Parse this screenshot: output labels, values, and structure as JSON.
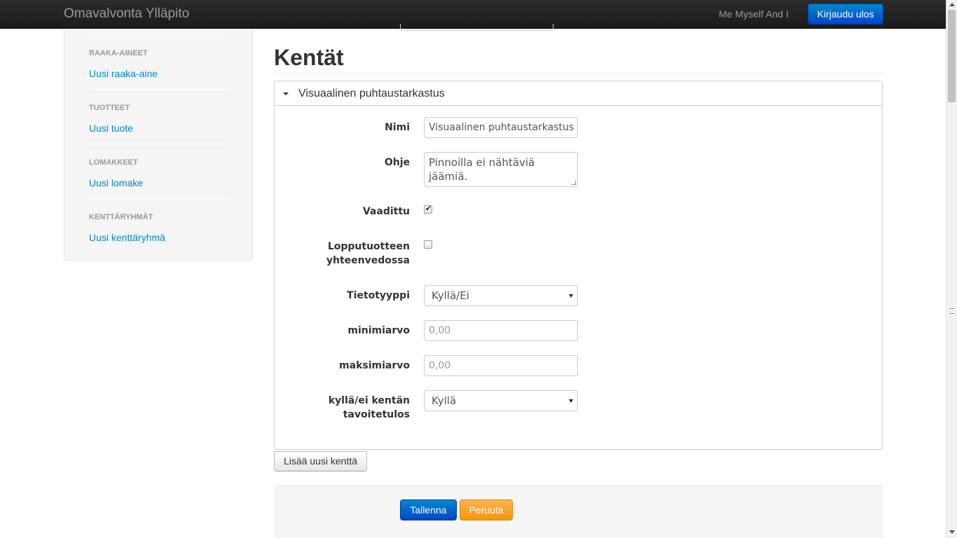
{
  "navbar": {
    "brand": "Omavalvonta Ylläpito",
    "user": "Me Myself And I",
    "logout_label": "Kirjaudu ulos"
  },
  "sidebar": {
    "sections": [
      {
        "header": "RAAKA-AINEET",
        "link": "Uusi raaka-aine"
      },
      {
        "header": "TUOTTEET",
        "link": "Uusi tuote"
      },
      {
        "header": "LOMAKKEET",
        "link": "Uusi lomake"
      },
      {
        "header": "KENTTÄRYHMÄT",
        "link": "Uusi kenttäryhmä"
      }
    ]
  },
  "main": {
    "title": "Kentät",
    "panel": {
      "title": "Visuaalinen puhtaustarkastus",
      "fields": {
        "nimi_label": "Nimi",
        "nimi_value": "Visuaalinen puhtaustarkastus",
        "ohje_label": "Ohje",
        "ohje_value": "Pinnoilla ei nähtäviä jäämiä.",
        "vaadittu_label": "Vaadittu",
        "vaadittu_checked": true,
        "lopputuote_label_1": "Lopputuotteen",
        "lopputuote_label_2": "yhteenvedossa",
        "lopputuote_checked": false,
        "tietotyyppi_label": "Tietotyyppi",
        "tietotyyppi_value": "Kyllä/Ei",
        "minimiarvo_label": "minimiarvo",
        "minimiarvo_placeholder": "0,00",
        "maksimiarvo_label": "maksimiarvo",
        "maksimiarvo_placeholder": "0,00",
        "tavoite_label_1": "kyllä/ei kentän",
        "tavoite_label_2": "tavoitetulos",
        "tavoite_value": "Kyllä"
      }
    },
    "add_field_label": "Lisää uusi kenttä",
    "save_label": "Tallenna",
    "cancel_label": "Peruuta"
  },
  "colors": {
    "primary": "#0088cc",
    "warning": "#f89406",
    "navbar": "#1b1b1b"
  }
}
